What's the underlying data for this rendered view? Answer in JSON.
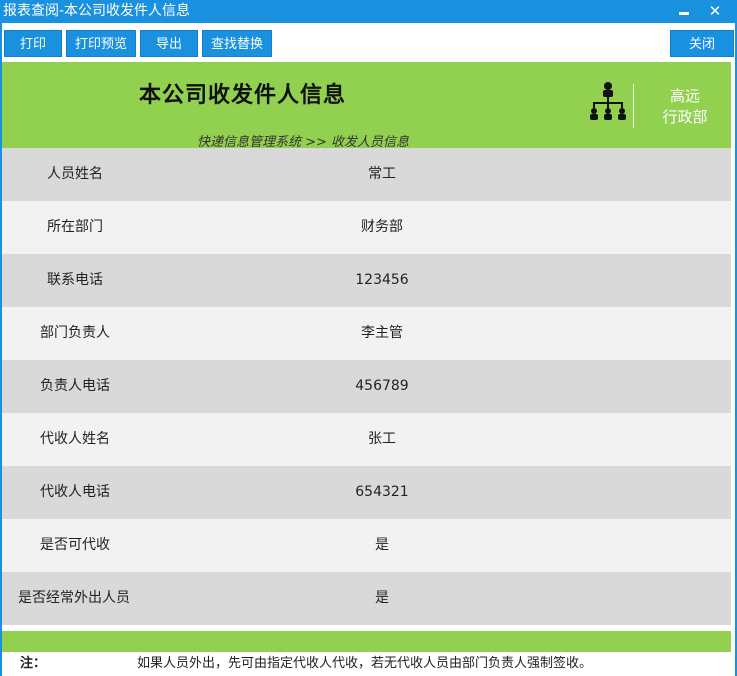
{
  "window": {
    "title": "报表查阅-本公司收发件人信息"
  },
  "toolbar": {
    "print": "打印",
    "print_preview": "打印预览",
    "export": "导出",
    "find_replace": "查找替换",
    "close": "关闭"
  },
  "header": {
    "title": "本公司收发件人信息",
    "breadcrumb": "快递信息管理系统 >> 收发人员信息",
    "dept_line1": "高远",
    "dept_line2": "行政部",
    "icon": "org-chart-icon"
  },
  "fields": [
    {
      "label": "人员姓名",
      "value": "常工"
    },
    {
      "label": "所在部门",
      "value": "财务部"
    },
    {
      "label": "联系电话",
      "value": "123456"
    },
    {
      "label": "部门负责人",
      "value": "李主管"
    },
    {
      "label": "负责人电话",
      "value": "456789"
    },
    {
      "label": "代收人姓名",
      "value": "张工"
    },
    {
      "label": "代收人电话",
      "value": "654321"
    },
    {
      "label": "是否可代收",
      "value": "是"
    },
    {
      "label": "是否经常外出人员",
      "value": "是"
    }
  ],
  "note": {
    "label": "注：",
    "text": "如果人员外出，先可由指定代收人代收，若无代收人员由部门负责人强制签收。"
  },
  "colors": {
    "title_bar": "#1a91df",
    "header_green": "#92d050",
    "row_dark": "#d9d9d9",
    "row_light": "#f2f2f2"
  }
}
